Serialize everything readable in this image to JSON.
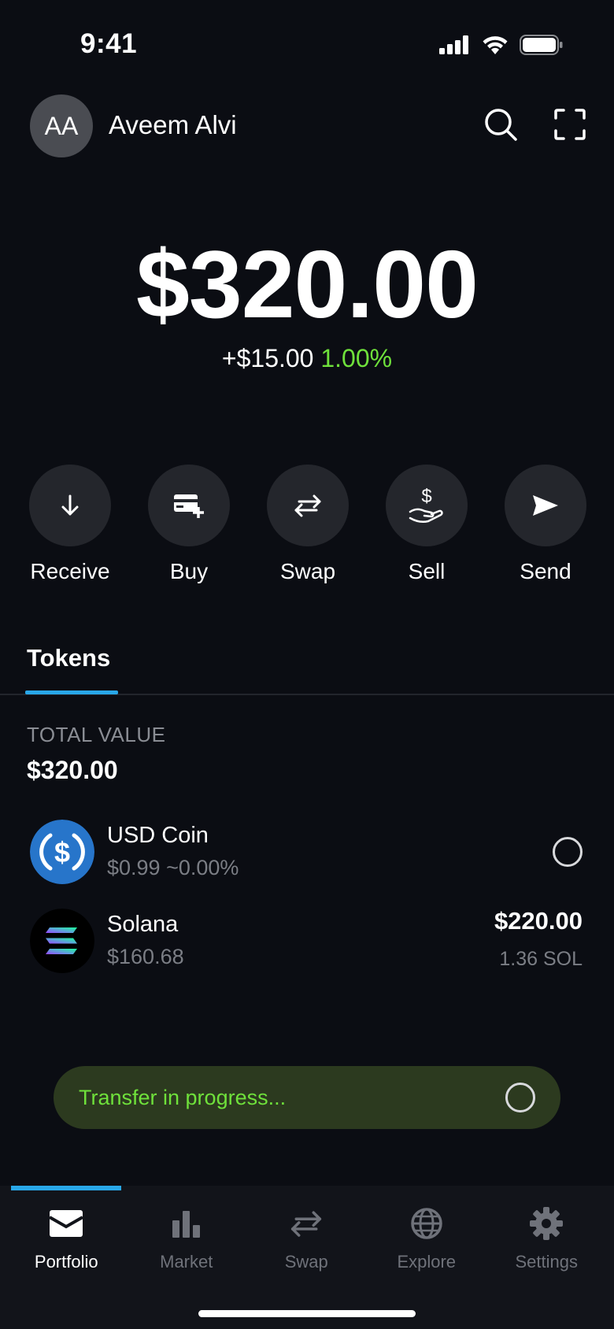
{
  "status_bar": {
    "time": "9:41",
    "icons": [
      "signal-icon",
      "wifi-icon",
      "battery-icon"
    ]
  },
  "header": {
    "avatar_initials": "AA",
    "username": "Aveem Alvi",
    "icons": [
      "search-icon",
      "scan-icon"
    ]
  },
  "balance": {
    "amount": "$320.00",
    "change_amount": "+$15.00",
    "change_percent": "1.00%"
  },
  "actions": [
    {
      "label": "Receive",
      "icon": "arrow-down-icon"
    },
    {
      "label": "Buy",
      "icon": "card-add-icon"
    },
    {
      "label": "Swap",
      "icon": "swap-arrows-icon"
    },
    {
      "label": "Sell",
      "icon": "hand-dollar-icon"
    },
    {
      "label": "Send",
      "icon": "paper-plane-icon"
    }
  ],
  "tabs": {
    "active": "Tokens"
  },
  "portfolio": {
    "total_label": "TOTAL VALUE",
    "total_value": "$320.00"
  },
  "tokens": [
    {
      "name": "USD Coin",
      "price_info": "$0.99 ~0.00%",
      "value": "",
      "amount": "",
      "loading": true,
      "icon": "usdc-logo"
    },
    {
      "name": "Solana",
      "price_info": "$160.68",
      "value": "$220.00",
      "amount": "1.36 SOL",
      "loading": false,
      "icon": "solana-logo"
    }
  ],
  "toast": {
    "message": "Transfer in progress..."
  },
  "bottom_nav": [
    {
      "label": "Portfolio",
      "icon": "portfolio-icon",
      "active": true
    },
    {
      "label": "Market",
      "icon": "bar-chart-icon",
      "active": false
    },
    {
      "label": "Swap",
      "icon": "swap-arrows-icon",
      "active": false
    },
    {
      "label": "Explore",
      "icon": "globe-icon",
      "active": false
    },
    {
      "label": "Settings",
      "icon": "gear-icon",
      "active": false
    }
  ],
  "colors": {
    "background": "#0b0d13",
    "accent_blue": "#29a7e8",
    "positive_green": "#6fe13b",
    "toast_bg": "#2c3a1f"
  }
}
